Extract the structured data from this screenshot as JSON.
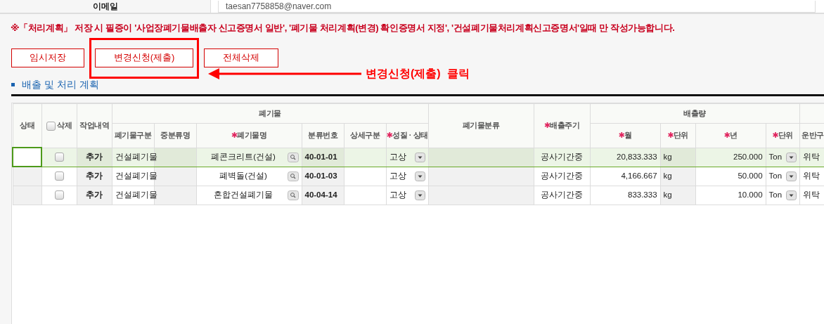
{
  "contact_row": {
    "label": "이메일",
    "value": "taesan7758858@naver.com"
  },
  "notice": "※「처리계획」 저장 시 필증이 '사업장폐기물배출자 신고증명서 일반', '폐기물 처리계획(변경) 확인증명서 지정', '건설폐기물처리계획신고증명서'일때 만 작성가능합니다.",
  "buttons": [
    {
      "label": "임시저장",
      "highlighted": false
    },
    {
      "label": "변경신청(제출)",
      "highlighted": true
    },
    {
      "label": "전체삭제",
      "highlighted": false
    }
  ],
  "callout": "변경신청(제출)  클릭",
  "section_title": "배출 및 처리 계획",
  "table": {
    "header_rows": [
      [
        {
          "label": "상태",
          "rowspan": 2
        },
        {
          "label": "삭제",
          "kind": "checkbox",
          "checked": false,
          "rowspan": 2
        },
        {
          "label": "작업내역",
          "rowspan": 2
        },
        {
          "label": "폐기물",
          "colspan": 6
        },
        {
          "label": "폐기물분류",
          "rowspan": 2
        },
        {
          "label": "배출주기",
          "required_mark": "✱",
          "rowspan": 2
        },
        {
          "label": "배출량",
          "colspan": 4
        },
        {}
      ],
      [
        {
          "label": "폐기물구분"
        },
        {
          "label": "중분류명"
        },
        {
          "label": "폐기물명",
          "required_mark": "✱"
        },
        {
          "label": "분류번호"
        },
        {
          "label": "상세구분"
        },
        {
          "label": "성질 · 상태",
          "required_mark": "✱"
        },
        {
          "label": "월",
          "required_mark": "✱"
        },
        {
          "label": "단위",
          "required_mark": "✱"
        },
        {
          "label": "년",
          "required_mark": "✱"
        },
        {
          "label": "단위",
          "required_mark": "✱"
        },
        {
          "label": "운반구"
        }
      ]
    ],
    "columns": [
      {
        "kind": "status",
        "readonly": true
      },
      {
        "kind": "checkbox",
        "readonly": false
      },
      {
        "kind": "label",
        "readonly": true
      },
      {
        "kind": "text",
        "readonly": false
      },
      {
        "kind": "text",
        "readonly": true
      },
      {
        "kind": "lookup",
        "readonly": false
      },
      {
        "kind": "code",
        "readonly": true
      },
      {
        "kind": "text",
        "readonly": false
      },
      {
        "kind": "select",
        "readonly": false
      },
      {
        "kind": "text",
        "readonly": true
      },
      {
        "kind": "center",
        "readonly": false
      },
      {
        "kind": "number",
        "readonly": false
      },
      {
        "kind": "text",
        "readonly": true
      },
      {
        "kind": "number",
        "readonly": false
      },
      {
        "kind": "select",
        "readonly": false
      },
      {
        "kind": "text",
        "readonly": false
      }
    ],
    "rows": [
      {
        "selected": true,
        "cells": [
          {},
          {
            "checked": false
          },
          {
            "text": "추가"
          },
          {
            "text": "건설폐기물"
          },
          {},
          {
            "text": "폐콘크리트(건설)"
          },
          {
            "text": "40-01-01"
          },
          {},
          {
            "text": "고상"
          },
          {},
          {
            "text": "공사기간중"
          },
          {
            "text": "20,833.333"
          },
          {
            "text": "kg"
          },
          {
            "text": "250.000"
          },
          {
            "text": "Ton"
          },
          {
            "text": "위탁"
          }
        ]
      },
      {
        "selected": false,
        "cells": [
          {},
          {
            "checked": false
          },
          {
            "text": "추가"
          },
          {
            "text": "건설폐기물"
          },
          {},
          {
            "text": "폐벽돌(건설)"
          },
          {
            "text": "40-01-03"
          },
          {},
          {
            "text": "고상"
          },
          {},
          {
            "text": "공사기간중"
          },
          {
            "text": "4,166.667"
          },
          {
            "text": "kg"
          },
          {
            "text": "50.000"
          },
          {
            "text": "Ton"
          },
          {
            "text": "위탁"
          }
        ]
      },
      {
        "selected": false,
        "cells": [
          {},
          {
            "checked": false
          },
          {
            "text": "추가"
          },
          {
            "text": "건설폐기물"
          },
          {},
          {
            "text": "혼합건설폐기물"
          },
          {
            "text": "40-04-14"
          },
          {},
          {
            "text": "고상"
          },
          {},
          {
            "text": "공사기간중"
          },
          {
            "text": "833.333"
          },
          {
            "text": "kg"
          },
          {
            "text": "10.000"
          },
          {
            "text": "Ton"
          },
          {
            "text": "위탁"
          }
        ]
      }
    ]
  }
}
